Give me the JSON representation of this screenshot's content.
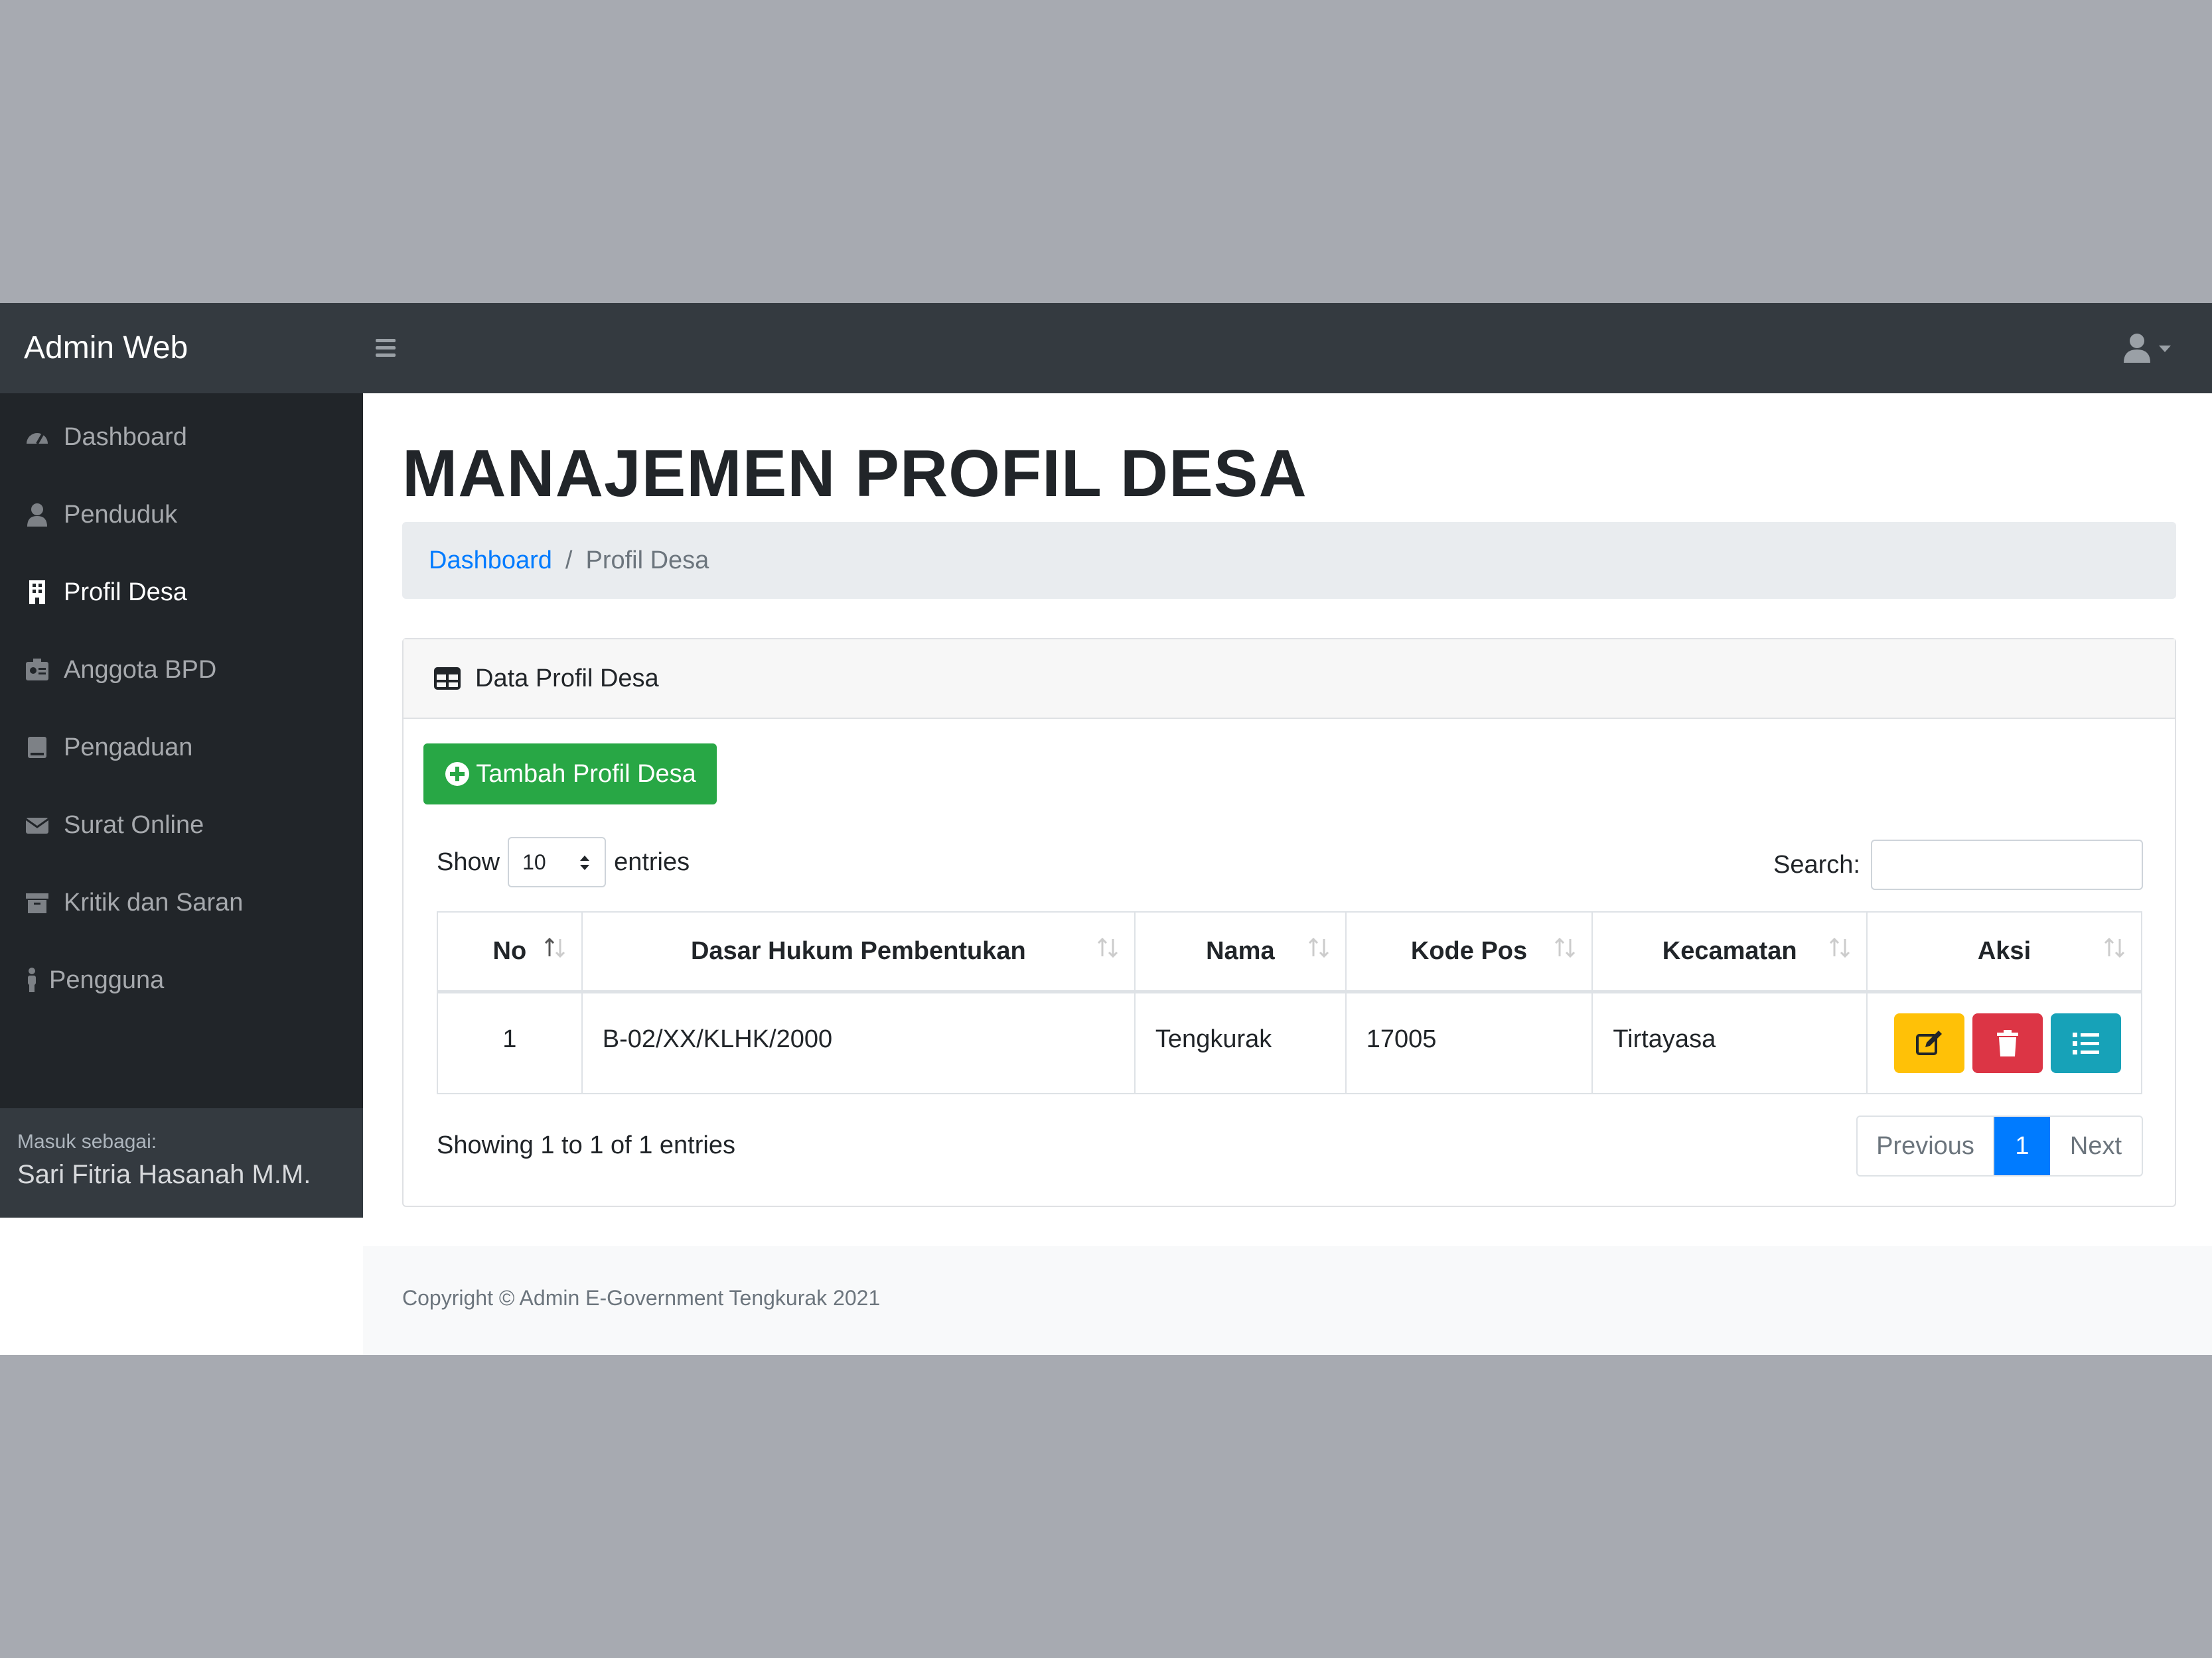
{
  "app": {
    "brand": "Admin Web"
  },
  "sidebar": {
    "items": [
      {
        "label": "Dashboard",
        "icon": "tachometer-icon"
      },
      {
        "label": "Penduduk",
        "icon": "user-icon"
      },
      {
        "label": "Profil Desa",
        "icon": "building-icon",
        "active": true
      },
      {
        "label": "Anggota BPD",
        "icon": "id-badge-icon"
      },
      {
        "label": "Pengaduan",
        "icon": "book-icon"
      },
      {
        "label": "Surat Online",
        "icon": "envelope-icon"
      },
      {
        "label": "Kritik dan Saran",
        "icon": "archive-icon"
      },
      {
        "label": "Pengguna",
        "icon": "male-icon"
      }
    ],
    "footer_label": "Masuk sebagai:",
    "footer_user": "Sari Fitria Hasanah M.M."
  },
  "page": {
    "title": "MANAJEMEN PROFIL DESA",
    "breadcrumb": {
      "link": "Dashboard",
      "separator": "/",
      "current": "Profil Desa"
    }
  },
  "card": {
    "title": "Data Profil Desa",
    "add_button": "Tambah Profil Desa",
    "show_label": "Show",
    "entries_value": "10",
    "entries_label": "entries",
    "search_label": "Search:",
    "search_value": ""
  },
  "table": {
    "columns": [
      "No",
      "Dasar Hukum Pembentukan",
      "Nama",
      "Kode Pos",
      "Kecamatan",
      "Aksi"
    ],
    "rows": [
      {
        "no": "1",
        "dasar_hukum": "B-02/XX/KLHK/2000",
        "nama": "Tengkurak",
        "kode_pos": "17005",
        "kecamatan": "Tirtayasa"
      }
    ],
    "actions": [
      {
        "name": "edit",
        "icon": "edit-icon",
        "color": "#ffc107"
      },
      {
        "name": "delete",
        "icon": "trash-icon",
        "color": "#dc3545"
      },
      {
        "name": "detail",
        "icon": "list-icon",
        "color": "#17a2b8"
      }
    ]
  },
  "pagination": {
    "info": "Showing 1 to 1 of 1 entries",
    "previous": "Previous",
    "current": "1",
    "next": "Next"
  },
  "footer": {
    "text": "Copyright © Admin E-Government Tengkurak 2021"
  },
  "colors": {
    "navbar": "#343a40",
    "sidebar": "#212529",
    "primary": "#007bff",
    "success": "#28a745"
  }
}
